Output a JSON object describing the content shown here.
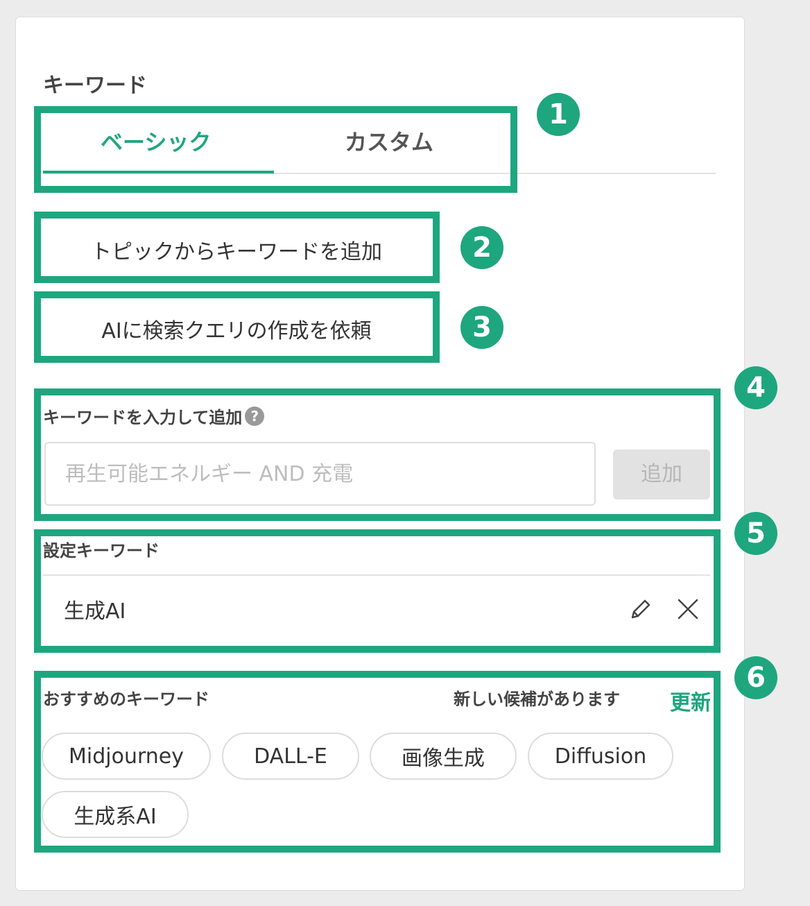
{
  "keyword_panel": {
    "title": "キーワード",
    "tabs": [
      {
        "label": "ベーシック",
        "active": true
      },
      {
        "label": "カスタム",
        "active": false
      }
    ],
    "topic_button_label": "トピックからキーワードを追加",
    "ai_button_label": "AIに検索クエリの作成を依頼",
    "input_section": {
      "label": "キーワードを入力して追加",
      "help_icon": "?",
      "placeholder": "再生可能エネルギー AND 充電",
      "add_button_label": "追加"
    },
    "set_keywords": {
      "label": "設定キーワード",
      "items": [
        "生成AI"
      ]
    },
    "recommended": {
      "label": "おすすめのキーワード",
      "new_candidates_text": "新しい候補があります",
      "refresh_label": "更新",
      "chips": [
        "Midjourney",
        "DALL-E",
        "画像生成",
        "Diffusion",
        "生成系AI"
      ]
    }
  },
  "annotations": {
    "badges": [
      "1",
      "2",
      "3",
      "4",
      "5",
      "6"
    ]
  },
  "colors": {
    "accent": "#1ea67f",
    "highlight_border": "#1ea67f",
    "disabled_button": "#e2e2e2",
    "background": "#ececec"
  },
  "icons": {
    "edit": "pencil-icon",
    "remove": "close-icon",
    "help": "question-circle-icon"
  }
}
